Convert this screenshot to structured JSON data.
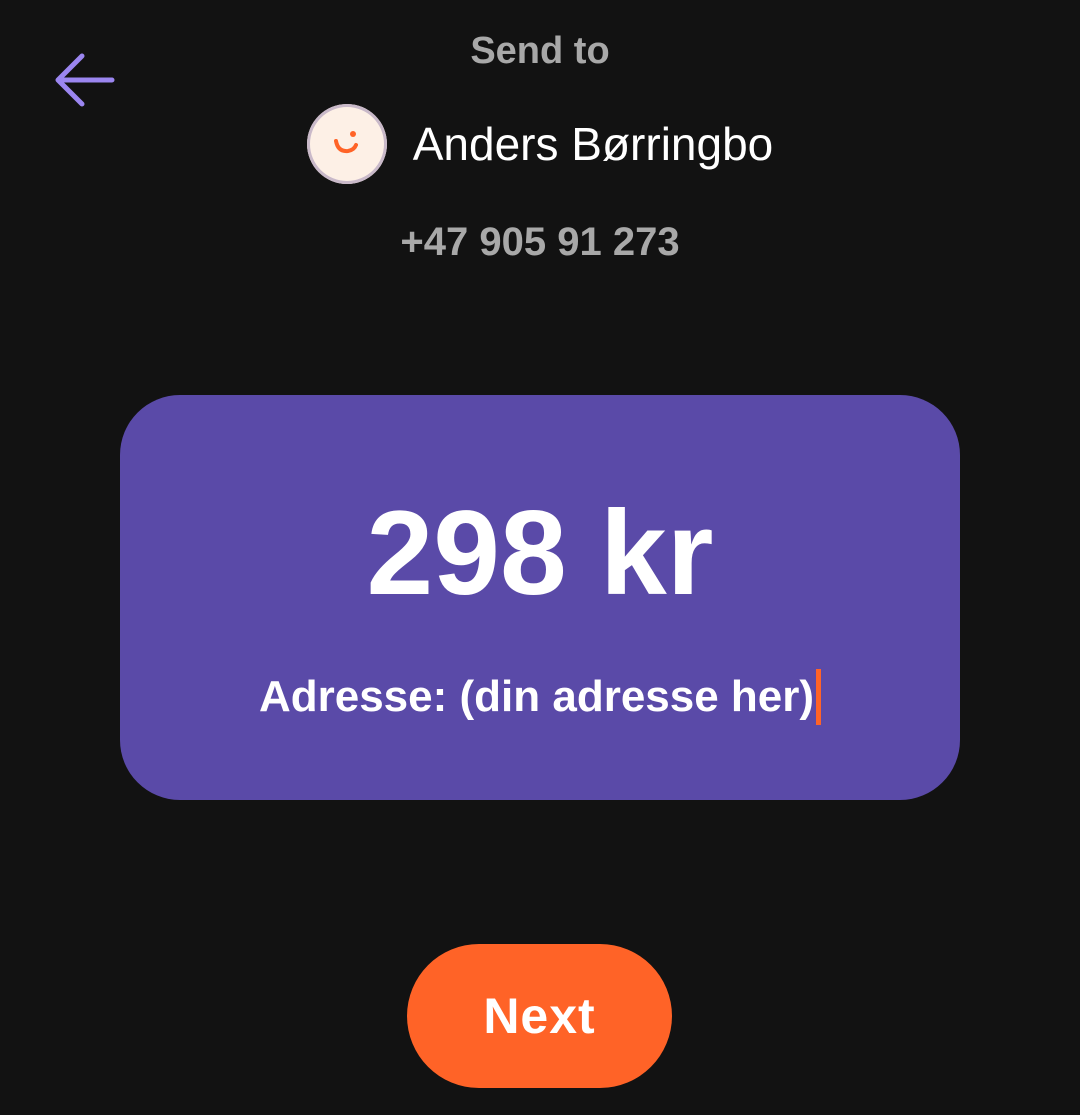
{
  "header": {
    "back_icon": "arrow-left-icon",
    "title": "Send to"
  },
  "recipient": {
    "avatar_icon": "smile-icon",
    "name": "Anders Børringbo",
    "phone": "+47 905 91 273"
  },
  "payment": {
    "amount": "298 kr",
    "message": "Adresse: (din adresse her)"
  },
  "actions": {
    "next_label": "Next"
  },
  "colors": {
    "background": "#121212",
    "card": "#5a4aa8",
    "accent_orange": "#ff6327",
    "back_arrow": "#9b86f0",
    "muted_text": "#a8a8a8"
  }
}
